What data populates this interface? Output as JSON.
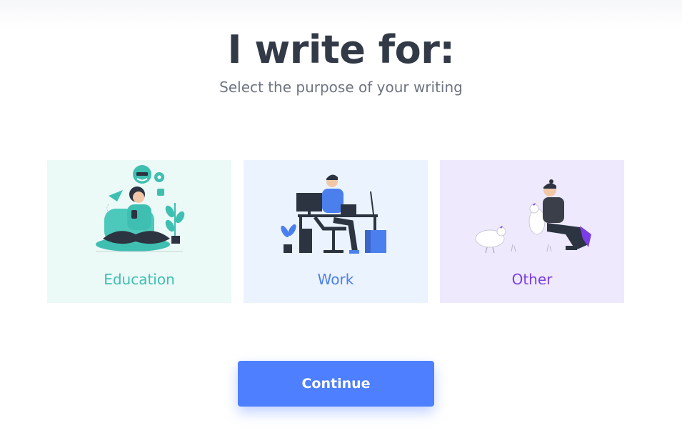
{
  "page": {
    "title": "I write for:",
    "subtitle": "Select the purpose of your writing"
  },
  "options": [
    {
      "id": "education",
      "label": "Education",
      "icon": "person-with-phone-illustration",
      "bg": "#ebf9f7",
      "color": "#3fbfb2"
    },
    {
      "id": "work",
      "label": "Work",
      "icon": "person-at-desk-illustration",
      "bg": "#ebf3fe",
      "color": "#4c7fee"
    },
    {
      "id": "other",
      "label": "Other",
      "icon": "person-with-chickens-illustration",
      "bg": "#efe9fd",
      "color": "#7a3ee6"
    }
  ],
  "actions": {
    "continue_label": "Continue",
    "continue_color": "#4d7ffe"
  }
}
